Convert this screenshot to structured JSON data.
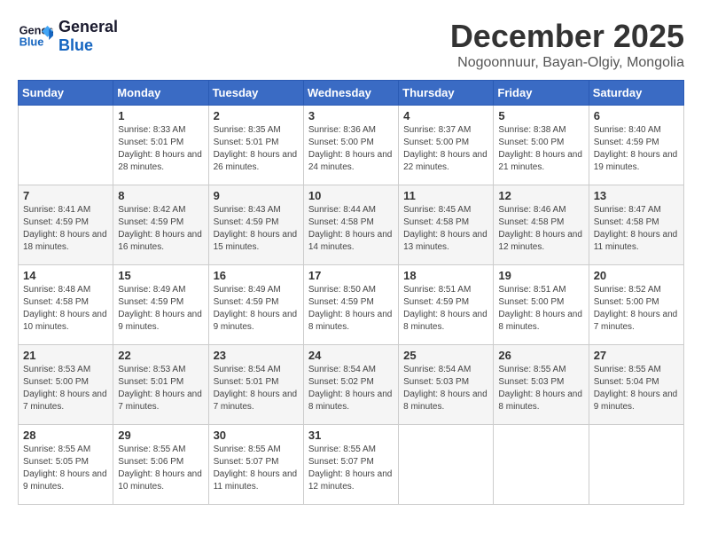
{
  "header": {
    "logo_line1": "General",
    "logo_line2": "Blue",
    "month": "December 2025",
    "location": "Nogoonnuur, Bayan-Olgiy, Mongolia"
  },
  "days_of_week": [
    "Sunday",
    "Monday",
    "Tuesday",
    "Wednesday",
    "Thursday",
    "Friday",
    "Saturday"
  ],
  "weeks": [
    [
      {
        "day": "",
        "sunrise": "",
        "sunset": "",
        "daylight": ""
      },
      {
        "day": "1",
        "sunrise": "Sunrise: 8:33 AM",
        "sunset": "Sunset: 5:01 PM",
        "daylight": "Daylight: 8 hours and 28 minutes."
      },
      {
        "day": "2",
        "sunrise": "Sunrise: 8:35 AM",
        "sunset": "Sunset: 5:01 PM",
        "daylight": "Daylight: 8 hours and 26 minutes."
      },
      {
        "day": "3",
        "sunrise": "Sunrise: 8:36 AM",
        "sunset": "Sunset: 5:00 PM",
        "daylight": "Daylight: 8 hours and 24 minutes."
      },
      {
        "day": "4",
        "sunrise": "Sunrise: 8:37 AM",
        "sunset": "Sunset: 5:00 PM",
        "daylight": "Daylight: 8 hours and 22 minutes."
      },
      {
        "day": "5",
        "sunrise": "Sunrise: 8:38 AM",
        "sunset": "Sunset: 5:00 PM",
        "daylight": "Daylight: 8 hours and 21 minutes."
      },
      {
        "day": "6",
        "sunrise": "Sunrise: 8:40 AM",
        "sunset": "Sunset: 4:59 PM",
        "daylight": "Daylight: 8 hours and 19 minutes."
      }
    ],
    [
      {
        "day": "7",
        "sunrise": "Sunrise: 8:41 AM",
        "sunset": "Sunset: 4:59 PM",
        "daylight": "Daylight: 8 hours and 18 minutes."
      },
      {
        "day": "8",
        "sunrise": "Sunrise: 8:42 AM",
        "sunset": "Sunset: 4:59 PM",
        "daylight": "Daylight: 8 hours and 16 minutes."
      },
      {
        "day": "9",
        "sunrise": "Sunrise: 8:43 AM",
        "sunset": "Sunset: 4:59 PM",
        "daylight": "Daylight: 8 hours and 15 minutes."
      },
      {
        "day": "10",
        "sunrise": "Sunrise: 8:44 AM",
        "sunset": "Sunset: 4:58 PM",
        "daylight": "Daylight: 8 hours and 14 minutes."
      },
      {
        "day": "11",
        "sunrise": "Sunrise: 8:45 AM",
        "sunset": "Sunset: 4:58 PM",
        "daylight": "Daylight: 8 hours and 13 minutes."
      },
      {
        "day": "12",
        "sunrise": "Sunrise: 8:46 AM",
        "sunset": "Sunset: 4:58 PM",
        "daylight": "Daylight: 8 hours and 12 minutes."
      },
      {
        "day": "13",
        "sunrise": "Sunrise: 8:47 AM",
        "sunset": "Sunset: 4:58 PM",
        "daylight": "Daylight: 8 hours and 11 minutes."
      }
    ],
    [
      {
        "day": "14",
        "sunrise": "Sunrise: 8:48 AM",
        "sunset": "Sunset: 4:58 PM",
        "daylight": "Daylight: 8 hours and 10 minutes."
      },
      {
        "day": "15",
        "sunrise": "Sunrise: 8:49 AM",
        "sunset": "Sunset: 4:59 PM",
        "daylight": "Daylight: 8 hours and 9 minutes."
      },
      {
        "day": "16",
        "sunrise": "Sunrise: 8:49 AM",
        "sunset": "Sunset: 4:59 PM",
        "daylight": "Daylight: 8 hours and 9 minutes."
      },
      {
        "day": "17",
        "sunrise": "Sunrise: 8:50 AM",
        "sunset": "Sunset: 4:59 PM",
        "daylight": "Daylight: 8 hours and 8 minutes."
      },
      {
        "day": "18",
        "sunrise": "Sunrise: 8:51 AM",
        "sunset": "Sunset: 4:59 PM",
        "daylight": "Daylight: 8 hours and 8 minutes."
      },
      {
        "day": "19",
        "sunrise": "Sunrise: 8:51 AM",
        "sunset": "Sunset: 5:00 PM",
        "daylight": "Daylight: 8 hours and 8 minutes."
      },
      {
        "day": "20",
        "sunrise": "Sunrise: 8:52 AM",
        "sunset": "Sunset: 5:00 PM",
        "daylight": "Daylight: 8 hours and 7 minutes."
      }
    ],
    [
      {
        "day": "21",
        "sunrise": "Sunrise: 8:53 AM",
        "sunset": "Sunset: 5:00 PM",
        "daylight": "Daylight: 8 hours and 7 minutes."
      },
      {
        "day": "22",
        "sunrise": "Sunrise: 8:53 AM",
        "sunset": "Sunset: 5:01 PM",
        "daylight": "Daylight: 8 hours and 7 minutes."
      },
      {
        "day": "23",
        "sunrise": "Sunrise: 8:54 AM",
        "sunset": "Sunset: 5:01 PM",
        "daylight": "Daylight: 8 hours and 7 minutes."
      },
      {
        "day": "24",
        "sunrise": "Sunrise: 8:54 AM",
        "sunset": "Sunset: 5:02 PM",
        "daylight": "Daylight: 8 hours and 8 minutes."
      },
      {
        "day": "25",
        "sunrise": "Sunrise: 8:54 AM",
        "sunset": "Sunset: 5:03 PM",
        "daylight": "Daylight: 8 hours and 8 minutes."
      },
      {
        "day": "26",
        "sunrise": "Sunrise: 8:55 AM",
        "sunset": "Sunset: 5:03 PM",
        "daylight": "Daylight: 8 hours and 8 minutes."
      },
      {
        "day": "27",
        "sunrise": "Sunrise: 8:55 AM",
        "sunset": "Sunset: 5:04 PM",
        "daylight": "Daylight: 8 hours and 9 minutes."
      }
    ],
    [
      {
        "day": "28",
        "sunrise": "Sunrise: 8:55 AM",
        "sunset": "Sunset: 5:05 PM",
        "daylight": "Daylight: 8 hours and 9 minutes."
      },
      {
        "day": "29",
        "sunrise": "Sunrise: 8:55 AM",
        "sunset": "Sunset: 5:06 PM",
        "daylight": "Daylight: 8 hours and 10 minutes."
      },
      {
        "day": "30",
        "sunrise": "Sunrise: 8:55 AM",
        "sunset": "Sunset: 5:07 PM",
        "daylight": "Daylight: 8 hours and 11 minutes."
      },
      {
        "day": "31",
        "sunrise": "Sunrise: 8:55 AM",
        "sunset": "Sunset: 5:07 PM",
        "daylight": "Daylight: 8 hours and 12 minutes."
      },
      {
        "day": "",
        "sunrise": "",
        "sunset": "",
        "daylight": ""
      },
      {
        "day": "",
        "sunrise": "",
        "sunset": "",
        "daylight": ""
      },
      {
        "day": "",
        "sunrise": "",
        "sunset": "",
        "daylight": ""
      }
    ]
  ]
}
